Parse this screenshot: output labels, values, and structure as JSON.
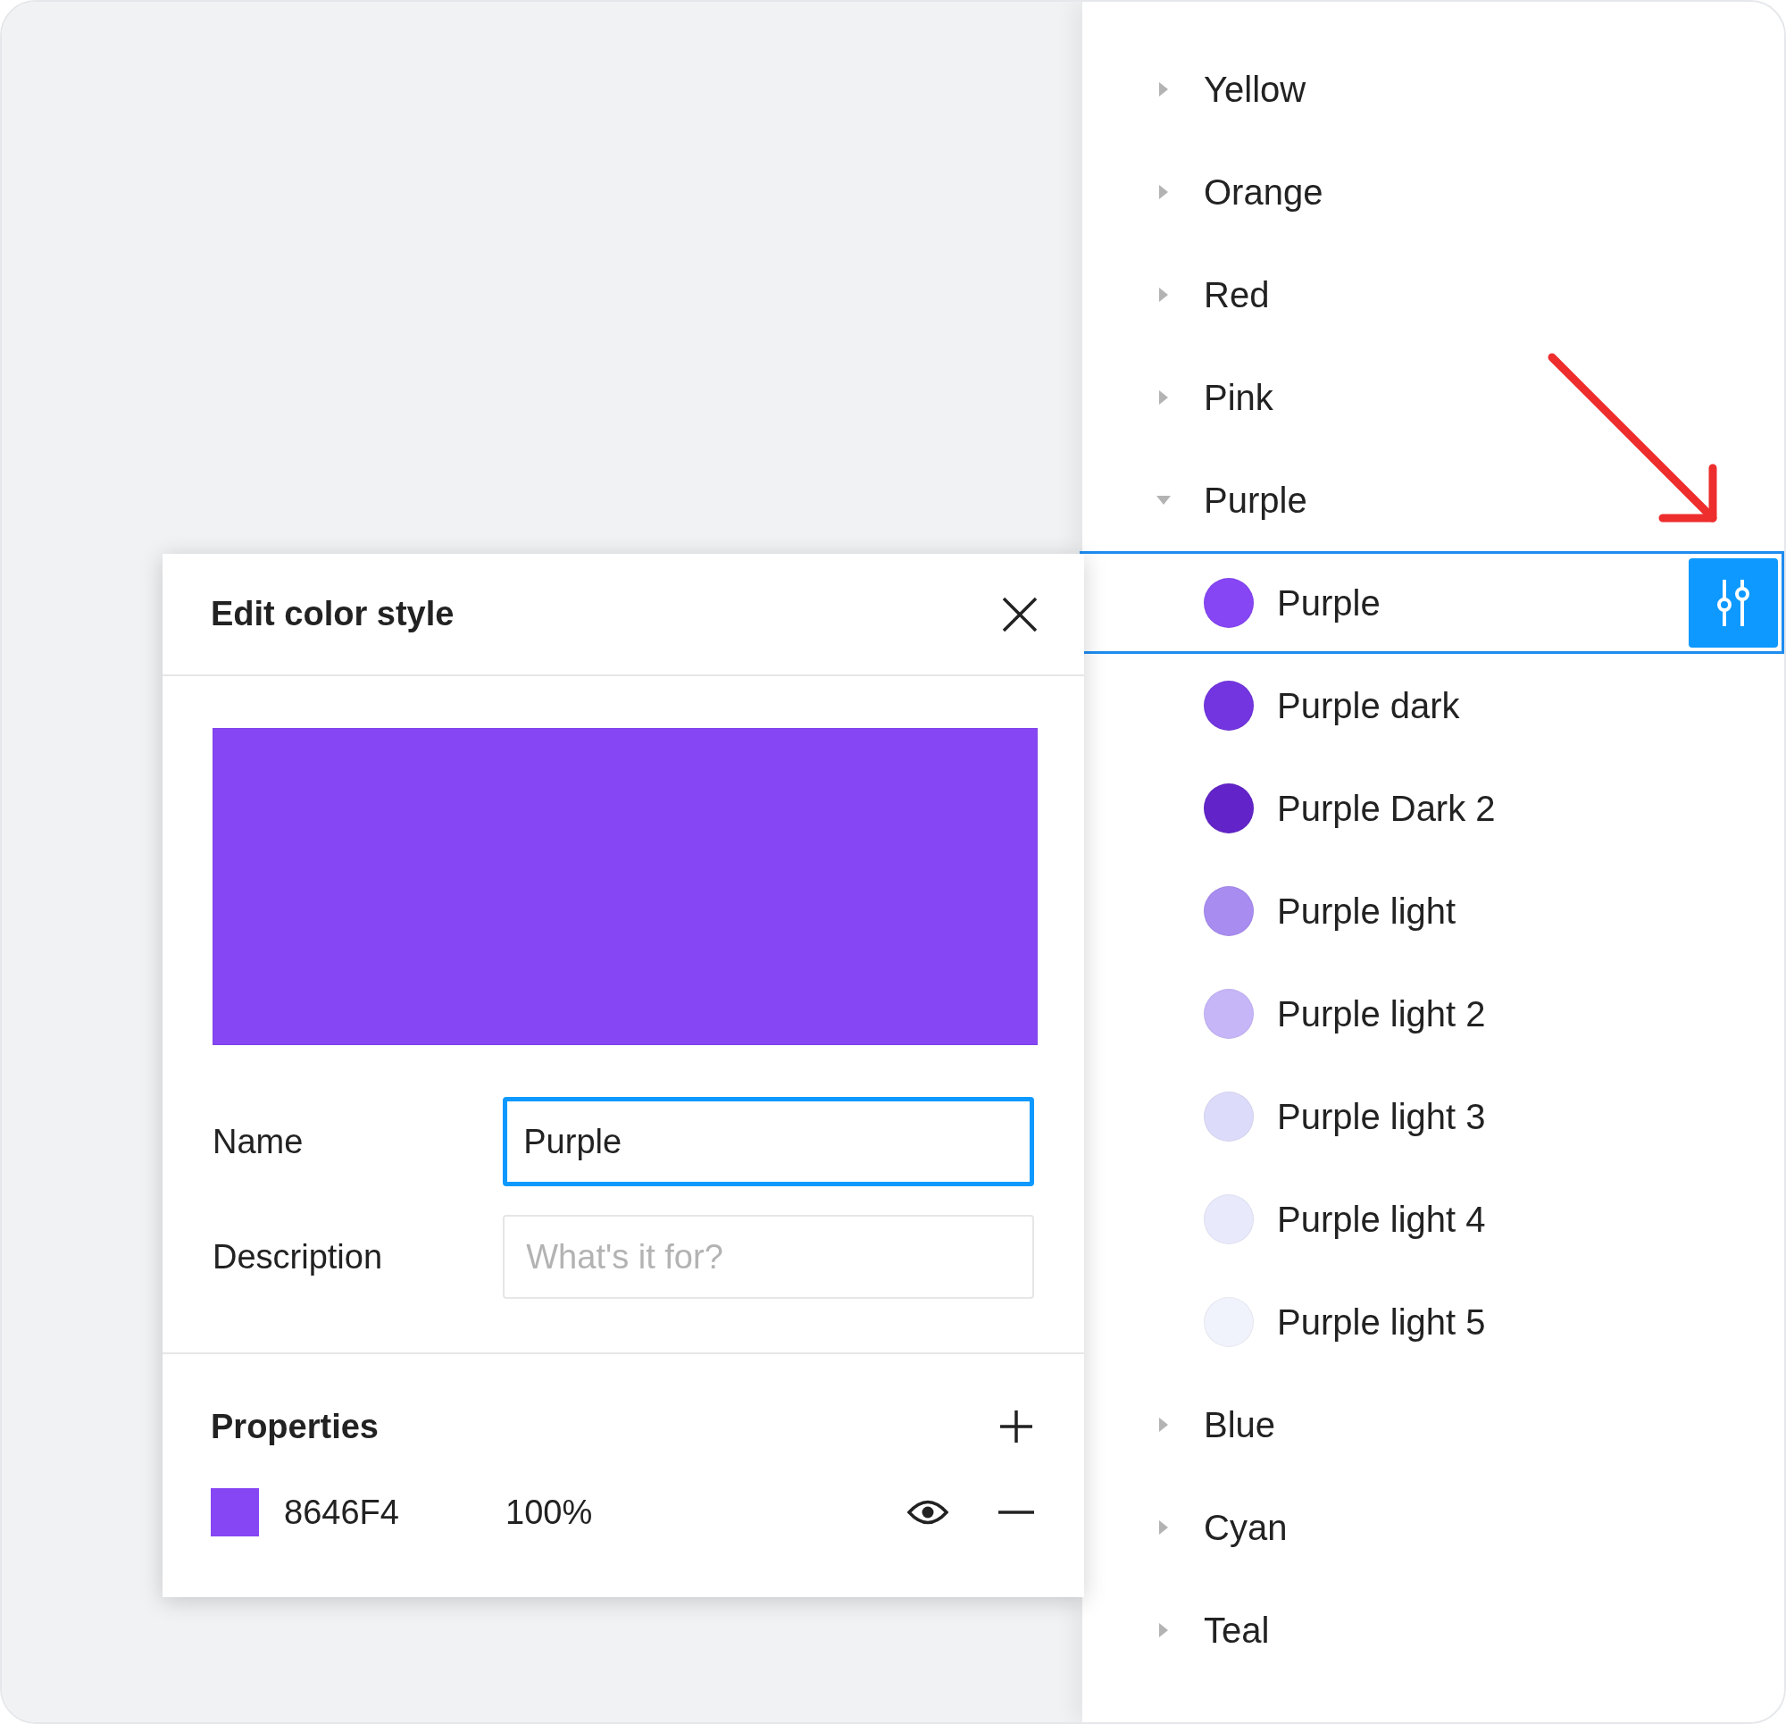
{
  "styles_panel": {
    "groups": [
      {
        "label": "Yellow",
        "expanded": false
      },
      {
        "label": "Orange",
        "expanded": false
      },
      {
        "label": "Red",
        "expanded": false
      },
      {
        "label": "Pink",
        "expanded": false
      },
      {
        "label": "Purple",
        "expanded": true,
        "children": [
          {
            "label": "Purple",
            "color": "#8646f4",
            "selected": true
          },
          {
            "label": "Purple dark",
            "color": "#7235e0",
            "selected": false
          },
          {
            "label": "Purple Dark 2",
            "color": "#6224c8",
            "selected": false
          },
          {
            "label": "Purple light",
            "color": "#a88cf0",
            "selected": false
          },
          {
            "label": "Purple light 2",
            "color": "#c6b6f8",
            "selected": false
          },
          {
            "label": "Purple light 3",
            "color": "#dcdcfa",
            "selected": false
          },
          {
            "label": "Purple light 4",
            "color": "#e8eafc",
            "selected": false
          },
          {
            "label": "Purple light 5",
            "color": "#f1f3fc",
            "selected": false
          }
        ]
      },
      {
        "label": "Blue",
        "expanded": false
      },
      {
        "label": "Cyan",
        "expanded": false
      },
      {
        "label": "Teal",
        "expanded": false
      }
    ]
  },
  "edit_dialog": {
    "title": "Edit color style",
    "name_field": {
      "label": "Name",
      "value": "Purple",
      "focused": true
    },
    "description_field": {
      "label": "Description",
      "placeholder": "What's it for?"
    },
    "properties": {
      "title": "Properties",
      "items": [
        {
          "hex": "8646F4",
          "opacity": "100%",
          "visible": true
        }
      ]
    }
  }
}
